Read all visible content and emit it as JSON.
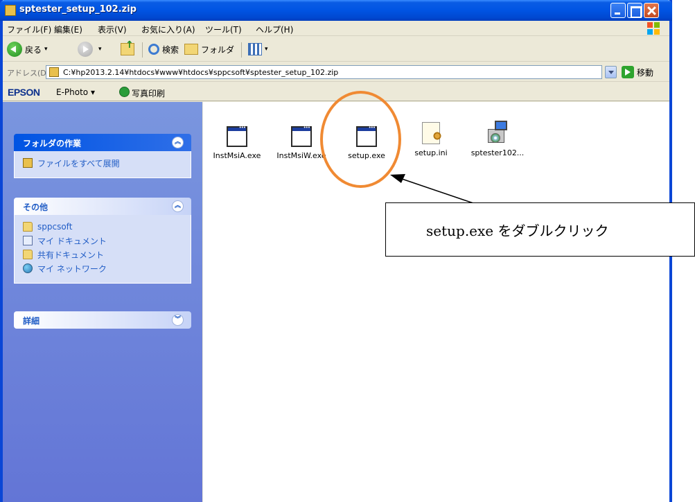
{
  "window": {
    "title": "sptester_setup_102.zip",
    "controls": [
      "minimize",
      "maximize",
      "close"
    ]
  },
  "menu": [
    "ファイル(F)",
    "編集(E)",
    "表示(V)",
    "お気に入り(A)",
    "ツール(T)",
    "ヘルプ(H)"
  ],
  "toolbar": {
    "back": "戻る",
    "search": "検索",
    "folders": "フォルダ"
  },
  "address": {
    "label": "アドレス(D)",
    "value": "C:¥hp2013.2.14¥htdocs¥www¥htdocs¥sppcsoft¥sptester_setup_102.zip",
    "go": "移動"
  },
  "epson_bar": {
    "logo": "EPSON",
    "ephoto": "E-Photo",
    "print": "写真印刷"
  },
  "left_panels": {
    "folder_tasks": {
      "title": "フォルダの作業",
      "items": [
        "ファイルをすべて展開"
      ]
    },
    "other": {
      "title": "その他",
      "items": [
        "sppcsoft",
        "マイ ドキュメント",
        "共有ドキュメント",
        "マイ ネットワーク"
      ]
    },
    "details": {
      "title": "詳細"
    }
  },
  "files": [
    {
      "name": "InstMsiA.exe",
      "type": "exe"
    },
    {
      "name": "InstMsiW.exe",
      "type": "exe"
    },
    {
      "name": "setup.exe",
      "type": "exe"
    },
    {
      "name": "setup.ini",
      "type": "ini"
    },
    {
      "name": "sptester102...",
      "type": "msi"
    }
  ],
  "annotation": {
    "callout": "setup.exe をダブルクリック",
    "highlight_color": "#f08a33"
  }
}
